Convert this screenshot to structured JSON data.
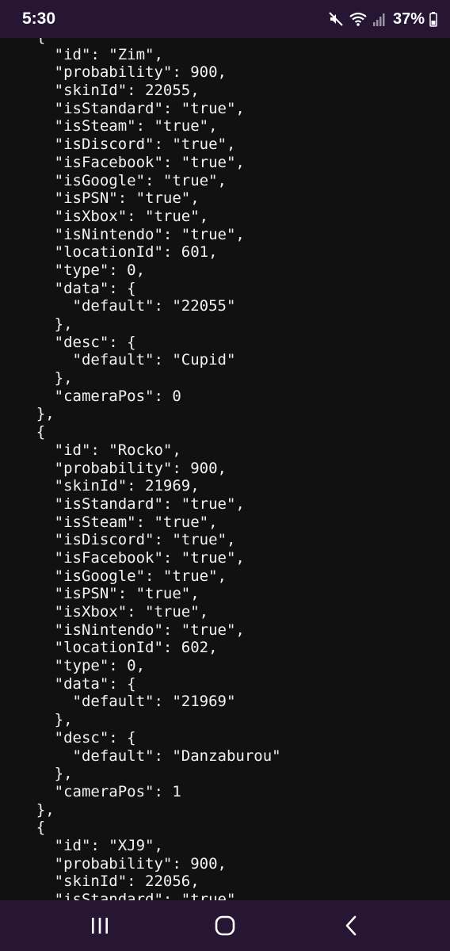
{
  "status_bar": {
    "time": "5:30",
    "battery": "37%",
    "icons": [
      "mute-icon",
      "wifi-icon",
      "signal-icon",
      "battery-icon"
    ]
  },
  "code": {
    "lines": [
      "    {",
      "      \"id\": \"Zim\",",
      "      \"probability\": 900,",
      "      \"skinId\": 22055,",
      "      \"isStandard\": \"true\",",
      "      \"isSteam\": \"true\",",
      "      \"isDiscord\": \"true\",",
      "      \"isFacebook\": \"true\",",
      "      \"isGoogle\": \"true\",",
      "      \"isPSN\": \"true\",",
      "      \"isXbox\": \"true\",",
      "      \"isNintendo\": \"true\",",
      "      \"locationId\": 601,",
      "      \"type\": 0,",
      "      \"data\": {",
      "        \"default\": \"22055\"",
      "      },",
      "      \"desc\": {",
      "        \"default\": \"Cupid\"",
      "      },",
      "      \"cameraPos\": 0",
      "    },",
      "    {",
      "      \"id\": \"Rocko\",",
      "      \"probability\": 900,",
      "      \"skinId\": 21969,",
      "      \"isStandard\": \"true\",",
      "      \"isSteam\": \"true\",",
      "      \"isDiscord\": \"true\",",
      "      \"isFacebook\": \"true\",",
      "      \"isGoogle\": \"true\",",
      "      \"isPSN\": \"true\",",
      "      \"isXbox\": \"true\",",
      "      \"isNintendo\": \"true\",",
      "      \"locationId\": 602,",
      "      \"type\": 0,",
      "      \"data\": {",
      "        \"default\": \"21969\"",
      "      },",
      "      \"desc\": {",
      "        \"default\": \"Danzaburou\"",
      "      },",
      "      \"cameraPos\": 1",
      "    },",
      "    {",
      "      \"id\": \"XJ9\",",
      "      \"probability\": 900,",
      "      \"skinId\": 22056,",
      "      \"isStandard\": \"true\","
    ]
  },
  "nav_bar": {
    "buttons": [
      "recent-apps",
      "home",
      "back"
    ]
  },
  "colors": {
    "status_bar_bg": "#261533",
    "code_bg": "#111111",
    "code_text": "#f2f2f2"
  }
}
